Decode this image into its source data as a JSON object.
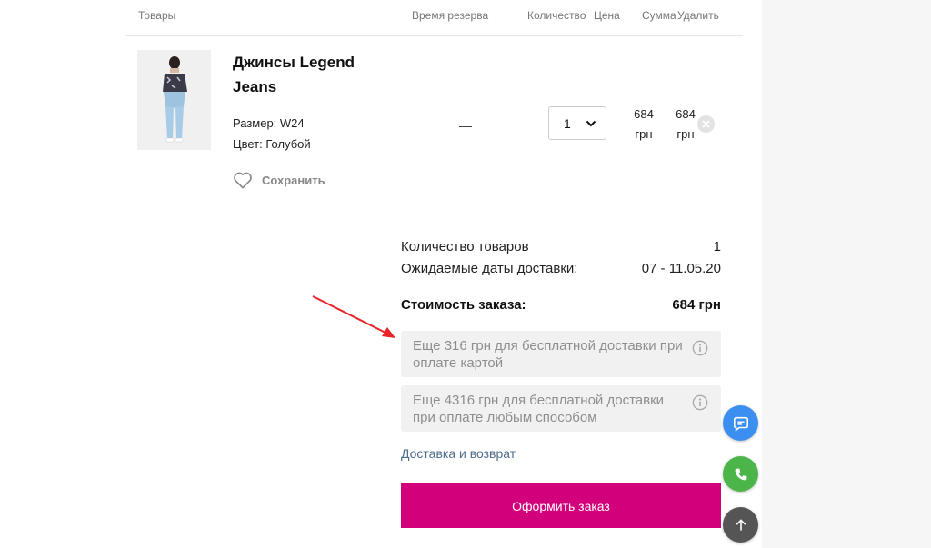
{
  "header": {
    "col_products": "Товары",
    "col_reserve": "Время резерва",
    "col_qty": "Количество",
    "col_price": "Цена",
    "col_sum": "Сумма",
    "col_remove": "Удалить"
  },
  "item": {
    "name": "Джинсы Legend Jeans",
    "size": "Размер: W24",
    "color": "Цвет: Голубой",
    "save_label": "Сохранить",
    "reserve": "—",
    "quantity": "1",
    "price_value": "684",
    "price_currency": "грн",
    "sum_value": "684",
    "sum_currency": "грн"
  },
  "summary": {
    "items_count_label": "Количество товаров",
    "items_count_value": "1",
    "delivery_dates_label": "Ожидаемые даты доставки:",
    "delivery_dates_value": "07 - 11.05.20",
    "order_total_label": "Стоимость заказа:",
    "order_total_value": "684 грн"
  },
  "notes": {
    "card_free_delivery": "Еще 316 грн для бесплатной доставки при оплате картой",
    "any_free_delivery": "Еще 4316 грн для бесплатной доставки при оплате любым способом"
  },
  "links": {
    "delivery_returns": "Доставка и возврат"
  },
  "cta": {
    "checkout_label": "Оформить заказ"
  },
  "icons": [
    "heart-icon",
    "chevron-down-icon",
    "close-icon",
    "info-icon",
    "chat-icon",
    "phone-icon",
    "arrow-up-icon",
    "red-arrow-annotation"
  ],
  "colors": {
    "brand": "#d2007a",
    "link": "#4d6d8c",
    "chat": "#3b8ff0",
    "phone": "#4cb54a",
    "scroll_top": "#555555",
    "annotation": "#e8232a"
  }
}
